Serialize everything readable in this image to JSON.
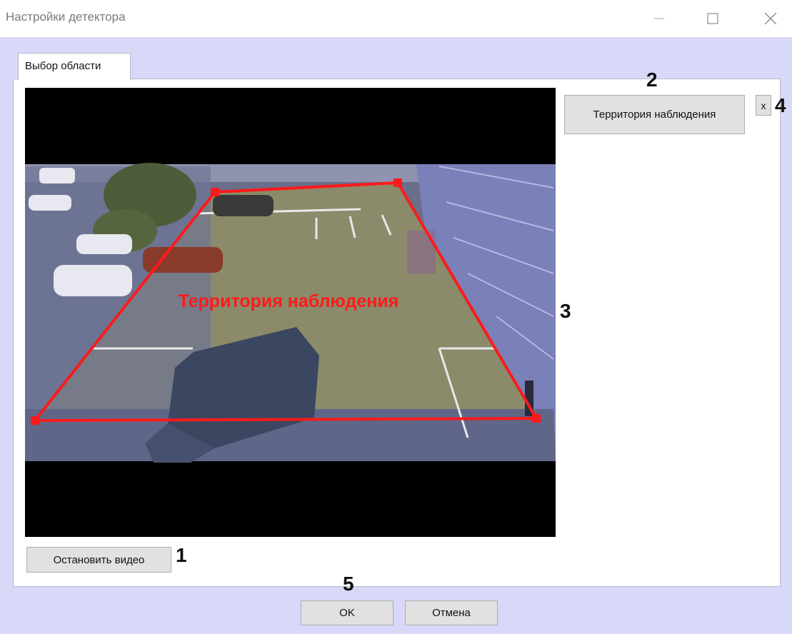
{
  "window": {
    "title": "Настройки детектора"
  },
  "tabs": [
    {
      "label": "Выбор области"
    }
  ],
  "zones": [
    {
      "label": "Территория наблюдения"
    }
  ],
  "zone_overlay": {
    "label": "Территория наблюдения",
    "color": "#ff1a1a"
  },
  "buttons": {
    "stop_video": "Остановить видео",
    "delete_zone": "x",
    "ok": "OK",
    "cancel": "Отмена"
  },
  "callouts": [
    "1",
    "2",
    "3",
    "4",
    "5"
  ],
  "icons": [
    "minimize-icon",
    "maximize-icon",
    "close-icon"
  ],
  "colors": {
    "client_bg": "#d8d8f8",
    "button_bg": "#e1e1e1",
    "zone": "#ff1a1a"
  }
}
